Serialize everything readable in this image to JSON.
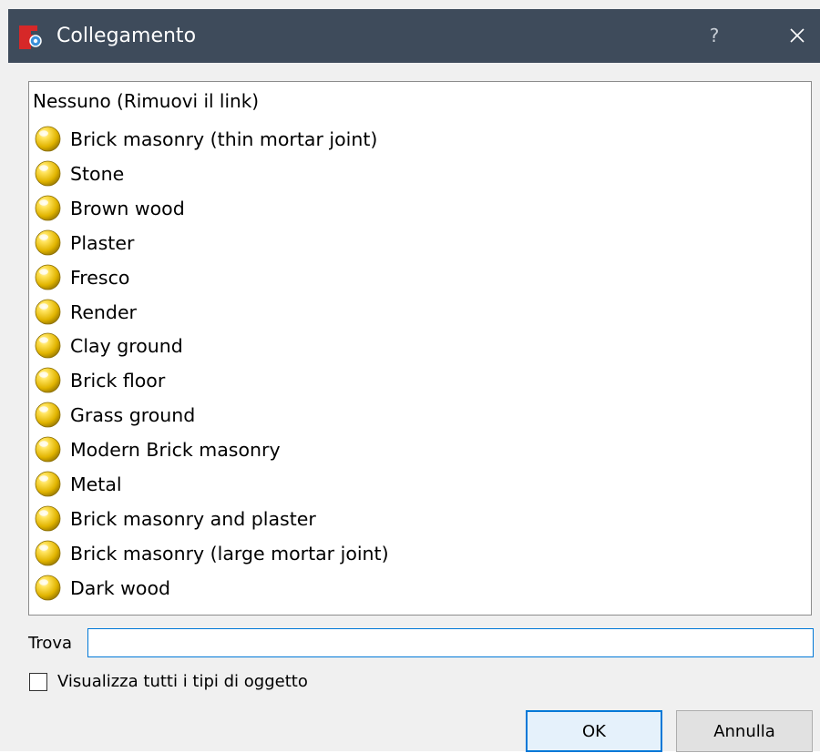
{
  "window": {
    "title": "Collegamento",
    "help_glyph": "?",
    "icons": {
      "app": "app-logo-icon",
      "close": "close-icon"
    },
    "colors": {
      "titlebar": "#3e4b5b",
      "accent": "#0078d7",
      "ball": "#f2c300"
    }
  },
  "list": {
    "header": "Nessuno (Rimuovi il link)",
    "item_icon": "material-ball-icon",
    "items": [
      "Brick masonry (thin mortar joint)",
      "Stone",
      "Brown wood",
      "Plaster",
      "Fresco",
      "Render",
      "Clay ground",
      "Brick floor",
      "Grass ground",
      "Modern Brick masonry",
      "Metal",
      "Brick masonry and plaster",
      "Brick masonry (large mortar joint)",
      "Dark wood"
    ]
  },
  "search": {
    "label": "Trova",
    "value": ""
  },
  "options": {
    "show_all_label": "Visualizza tutti i tipi di oggetto",
    "show_all_checked": false
  },
  "buttons": {
    "ok": "OK",
    "cancel": "Annulla"
  }
}
